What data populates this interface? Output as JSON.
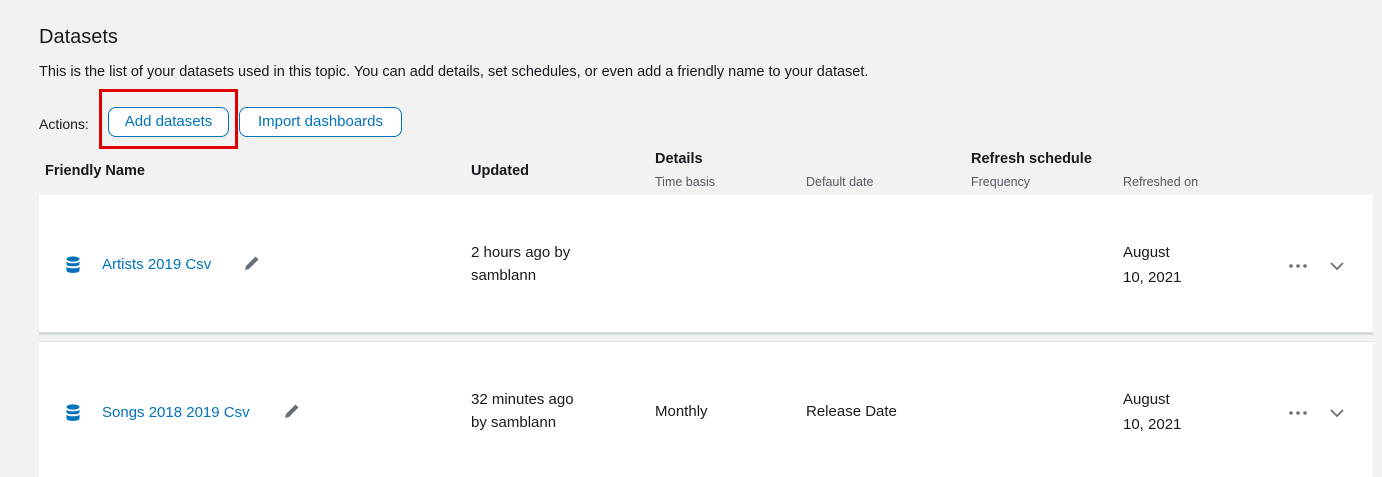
{
  "header": {
    "title": "Datasets",
    "description": "This is the list of your datasets used in this topic. You can add details, set schedules, or even add a friendly name to your dataset."
  },
  "actions": {
    "label": "Actions:",
    "add_datasets": "Add datasets",
    "import_dashboards": "Import dashboards"
  },
  "table": {
    "headers": {
      "friendly_name": "Friendly Name",
      "updated": "Updated",
      "details": "Details",
      "time_basis": "Time basis",
      "default_date": "Default date",
      "refresh_schedule": "Refresh schedule",
      "frequency": "Frequency",
      "refreshed_on": "Refreshed on"
    },
    "rows": [
      {
        "name": "Artists 2019 Csv",
        "updated_line1": "2 hours ago by",
        "updated_line2": "samblann",
        "time_basis": "",
        "default_date": "",
        "frequency": "",
        "refreshed_line1": "August",
        "refreshed_line2": "10, 2021"
      },
      {
        "name": "Songs 2018 2019 Csv",
        "updated_line1": "32 minutes ago",
        "updated_line2": "by samblann",
        "time_basis": "Monthly",
        "default_date": "Release Date",
        "frequency": "",
        "refreshed_line1": "August",
        "refreshed_line2": "10, 2021"
      }
    ]
  },
  "colors": {
    "accent": "#0073bb",
    "highlight": "#e00000",
    "background": "#f2f2f2"
  },
  "icons": [
    "database-icon",
    "pencil-icon",
    "more-icon",
    "chevron-down-icon"
  ]
}
